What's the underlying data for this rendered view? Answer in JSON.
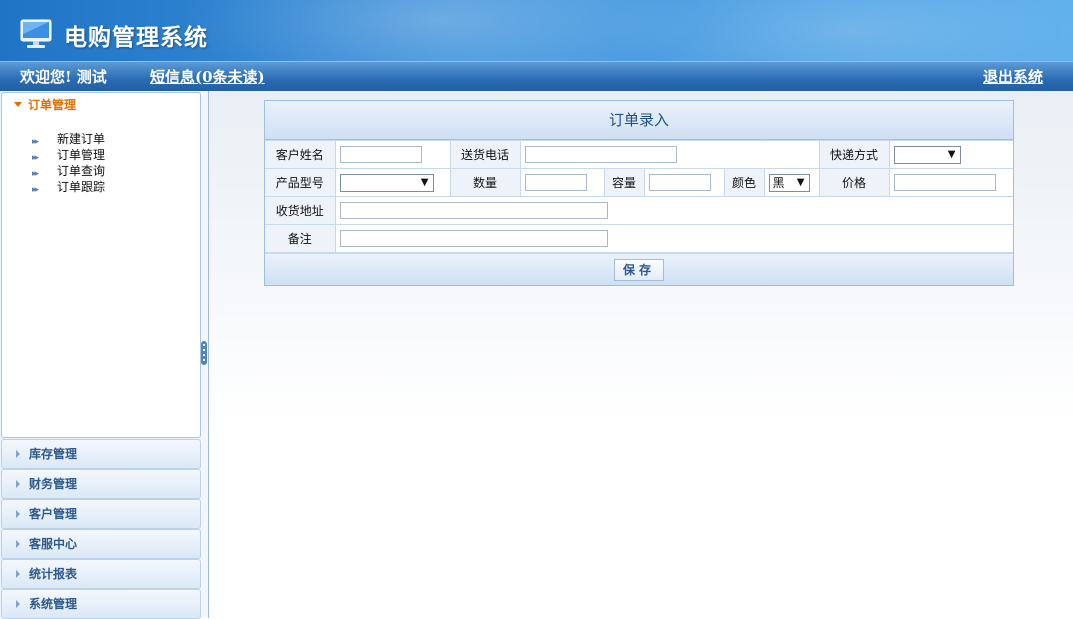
{
  "header": {
    "app_title": "电购管理系统",
    "icon": "monitor-icon"
  },
  "topbar": {
    "welcome": "欢迎您! 测试",
    "messages_link": "短信息(0条未读)",
    "logout_link": "退出系统"
  },
  "sidebar": {
    "open_panel": {
      "title": "订单管理",
      "items": [
        {
          "label": "新建订单"
        },
        {
          "label": "订单管理"
        },
        {
          "label": "订单查询"
        },
        {
          "label": "订单跟踪"
        }
      ]
    },
    "collapsed_panels": [
      {
        "label": "库存管理"
      },
      {
        "label": "财务管理"
      },
      {
        "label": "客户管理"
      },
      {
        "label": "客服中心"
      },
      {
        "label": "统计报表"
      },
      {
        "label": "系统管理"
      }
    ]
  },
  "form": {
    "title": "订单录入",
    "labels": {
      "customer_name": "客户姓名",
      "phone": "送货电话",
      "express": "快递方式",
      "product_model": "产品型号",
      "quantity": "数量",
      "capacity": "容量",
      "color": "颜色",
      "price": "价格",
      "address": "收货地址",
      "remark": "备注"
    },
    "values": {
      "customer_name": "",
      "phone": "",
      "express": "",
      "product_model": "",
      "quantity": "",
      "capacity": "",
      "color": "黑",
      "price": "",
      "address": "",
      "remark": ""
    },
    "save_button": "保存"
  },
  "colors": {
    "header_blue": "#2a6cb4",
    "active_menu_orange": "#e07000",
    "form_title_blue": "#1f4f86"
  }
}
